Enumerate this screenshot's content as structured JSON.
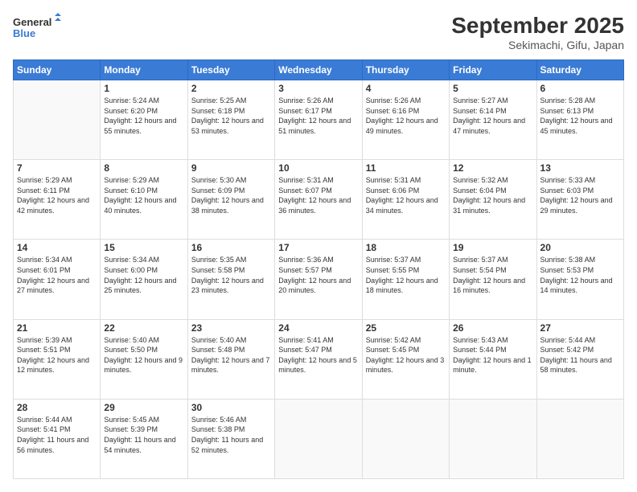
{
  "header": {
    "logo_line1": "General",
    "logo_line2": "Blue",
    "month": "September 2025",
    "location": "Sekimachi, Gifu, Japan"
  },
  "weekdays": [
    "Sunday",
    "Monday",
    "Tuesday",
    "Wednesday",
    "Thursday",
    "Friday",
    "Saturday"
  ],
  "weeks": [
    [
      {
        "day": "",
        "info": ""
      },
      {
        "day": "1",
        "info": "Sunrise: 5:24 AM\nSunset: 6:20 PM\nDaylight: 12 hours\nand 55 minutes."
      },
      {
        "day": "2",
        "info": "Sunrise: 5:25 AM\nSunset: 6:18 PM\nDaylight: 12 hours\nand 53 minutes."
      },
      {
        "day": "3",
        "info": "Sunrise: 5:26 AM\nSunset: 6:17 PM\nDaylight: 12 hours\nand 51 minutes."
      },
      {
        "day": "4",
        "info": "Sunrise: 5:26 AM\nSunset: 6:16 PM\nDaylight: 12 hours\nand 49 minutes."
      },
      {
        "day": "5",
        "info": "Sunrise: 5:27 AM\nSunset: 6:14 PM\nDaylight: 12 hours\nand 47 minutes."
      },
      {
        "day": "6",
        "info": "Sunrise: 5:28 AM\nSunset: 6:13 PM\nDaylight: 12 hours\nand 45 minutes."
      }
    ],
    [
      {
        "day": "7",
        "info": "Sunrise: 5:29 AM\nSunset: 6:11 PM\nDaylight: 12 hours\nand 42 minutes."
      },
      {
        "day": "8",
        "info": "Sunrise: 5:29 AM\nSunset: 6:10 PM\nDaylight: 12 hours\nand 40 minutes."
      },
      {
        "day": "9",
        "info": "Sunrise: 5:30 AM\nSunset: 6:09 PM\nDaylight: 12 hours\nand 38 minutes."
      },
      {
        "day": "10",
        "info": "Sunrise: 5:31 AM\nSunset: 6:07 PM\nDaylight: 12 hours\nand 36 minutes."
      },
      {
        "day": "11",
        "info": "Sunrise: 5:31 AM\nSunset: 6:06 PM\nDaylight: 12 hours\nand 34 minutes."
      },
      {
        "day": "12",
        "info": "Sunrise: 5:32 AM\nSunset: 6:04 PM\nDaylight: 12 hours\nand 31 minutes."
      },
      {
        "day": "13",
        "info": "Sunrise: 5:33 AM\nSunset: 6:03 PM\nDaylight: 12 hours\nand 29 minutes."
      }
    ],
    [
      {
        "day": "14",
        "info": "Sunrise: 5:34 AM\nSunset: 6:01 PM\nDaylight: 12 hours\nand 27 minutes."
      },
      {
        "day": "15",
        "info": "Sunrise: 5:34 AM\nSunset: 6:00 PM\nDaylight: 12 hours\nand 25 minutes."
      },
      {
        "day": "16",
        "info": "Sunrise: 5:35 AM\nSunset: 5:58 PM\nDaylight: 12 hours\nand 23 minutes."
      },
      {
        "day": "17",
        "info": "Sunrise: 5:36 AM\nSunset: 5:57 PM\nDaylight: 12 hours\nand 20 minutes."
      },
      {
        "day": "18",
        "info": "Sunrise: 5:37 AM\nSunset: 5:55 PM\nDaylight: 12 hours\nand 18 minutes."
      },
      {
        "day": "19",
        "info": "Sunrise: 5:37 AM\nSunset: 5:54 PM\nDaylight: 12 hours\nand 16 minutes."
      },
      {
        "day": "20",
        "info": "Sunrise: 5:38 AM\nSunset: 5:53 PM\nDaylight: 12 hours\nand 14 minutes."
      }
    ],
    [
      {
        "day": "21",
        "info": "Sunrise: 5:39 AM\nSunset: 5:51 PM\nDaylight: 12 hours\nand 12 minutes."
      },
      {
        "day": "22",
        "info": "Sunrise: 5:40 AM\nSunset: 5:50 PM\nDaylight: 12 hours\nand 9 minutes."
      },
      {
        "day": "23",
        "info": "Sunrise: 5:40 AM\nSunset: 5:48 PM\nDaylight: 12 hours\nand 7 minutes."
      },
      {
        "day": "24",
        "info": "Sunrise: 5:41 AM\nSunset: 5:47 PM\nDaylight: 12 hours\nand 5 minutes."
      },
      {
        "day": "25",
        "info": "Sunrise: 5:42 AM\nSunset: 5:45 PM\nDaylight: 12 hours\nand 3 minutes."
      },
      {
        "day": "26",
        "info": "Sunrise: 5:43 AM\nSunset: 5:44 PM\nDaylight: 12 hours\nand 1 minute."
      },
      {
        "day": "27",
        "info": "Sunrise: 5:44 AM\nSunset: 5:42 PM\nDaylight: 11 hours\nand 58 minutes."
      }
    ],
    [
      {
        "day": "28",
        "info": "Sunrise: 5:44 AM\nSunset: 5:41 PM\nDaylight: 11 hours\nand 56 minutes."
      },
      {
        "day": "29",
        "info": "Sunrise: 5:45 AM\nSunset: 5:39 PM\nDaylight: 11 hours\nand 54 minutes."
      },
      {
        "day": "30",
        "info": "Sunrise: 5:46 AM\nSunset: 5:38 PM\nDaylight: 11 hours\nand 52 minutes."
      },
      {
        "day": "",
        "info": ""
      },
      {
        "day": "",
        "info": ""
      },
      {
        "day": "",
        "info": ""
      },
      {
        "day": "",
        "info": ""
      }
    ]
  ]
}
